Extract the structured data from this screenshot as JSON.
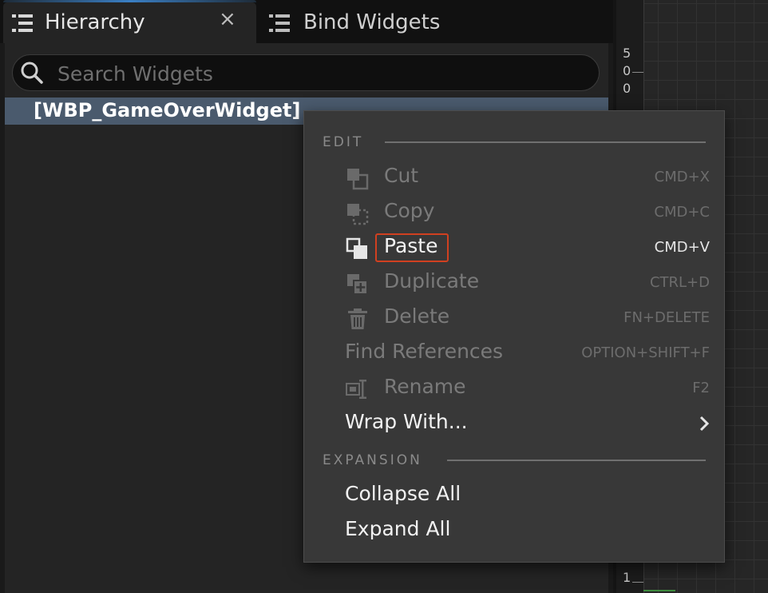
{
  "tabs": [
    {
      "label": "Hierarchy",
      "icon": "hierarchy-list-icon",
      "active": true,
      "close": "×"
    },
    {
      "label": "Bind Widgets",
      "icon": "hierarchy-list-icon",
      "active": false
    }
  ],
  "search": {
    "placeholder": "Search Widgets",
    "value": ""
  },
  "tree": {
    "root_label": "[WBP_GameOverWidget]"
  },
  "ruler": {
    "digits": [
      "5",
      "0",
      "0"
    ],
    "bottom_digit": "1"
  },
  "context_menu": {
    "sections": {
      "edit": "EDIT",
      "expansion": "EXPANSION"
    },
    "items": {
      "cut": {
        "label": "Cut",
        "shortcut": "CMD+X",
        "icon": "cut-icon"
      },
      "copy": {
        "label": "Copy",
        "shortcut": "CMD+C",
        "icon": "copy-icon"
      },
      "paste": {
        "label": "Paste",
        "shortcut": "CMD+V",
        "icon": "paste-icon"
      },
      "duplicate": {
        "label": "Duplicate",
        "shortcut": "CTRL+D",
        "icon": "duplicate-icon"
      },
      "delete": {
        "label": "Delete",
        "shortcut": "FN+DELETE",
        "icon": "trash-icon"
      },
      "find_references": {
        "label": "Find References",
        "shortcut": "OPTION+SHIFT+F"
      },
      "rename": {
        "label": "Rename",
        "shortcut": "F2",
        "icon": "rename-icon"
      },
      "wrap_with": {
        "label": "Wrap With...",
        "icon": "chevron-right-icon"
      },
      "collapse_all": {
        "label": "Collapse All"
      },
      "expand_all": {
        "label": "Expand All"
      }
    }
  },
  "colors": {
    "selection_row": "#4a5a6d",
    "menu_background": "#383838",
    "highlight_border": "#d04020",
    "active_tab_accent": "#3a7fc4"
  }
}
